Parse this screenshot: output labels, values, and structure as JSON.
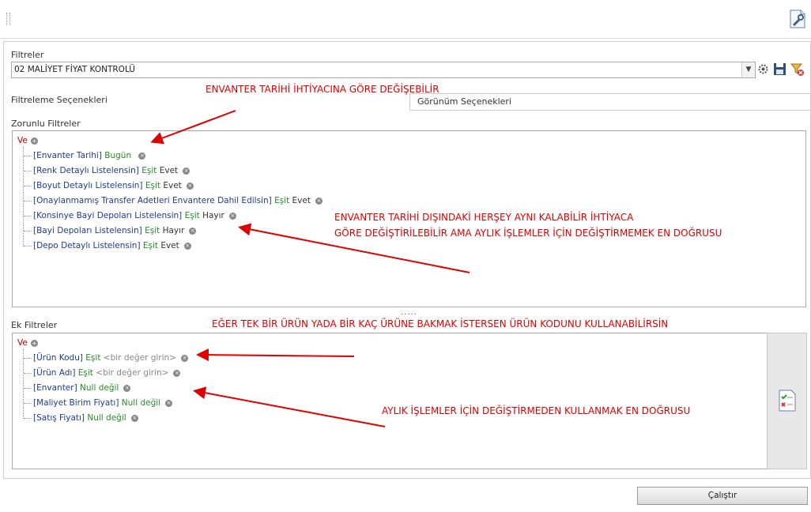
{
  "toolbar": {
    "settings_icon": "wrench-icon"
  },
  "filters": {
    "label": "Filtreler",
    "selected": "02 MALİYET FİYAT KONTROLÜ"
  },
  "tabs": {
    "left": "Filtreleme Seçenekleri",
    "right": "Görünüm Seçenekleri"
  },
  "required": {
    "label": "Zorunlu Filtreler",
    "root": "Ve",
    "items": [
      {
        "field": "[Envanter Tarihi]",
        "op": "Bugün",
        "val": ""
      },
      {
        "field": "[Renk Detaylı Listelensin]",
        "op": "Eşit",
        "val": "Evet"
      },
      {
        "field": "[Boyut Detaylı Listelensin]",
        "op": "Eşit",
        "val": "Evet"
      },
      {
        "field": "[Onaylanmamış Transfer Adetleri Envantere Dahil Edilsin]",
        "op": "Eşit",
        "val": "Evet"
      },
      {
        "field": "[Konsinye Bayi Depoları Listelensin]",
        "op": "Eşit",
        "val": "Hayır"
      },
      {
        "field": "[Bayi Depoları Listelensin]",
        "op": "Eşit",
        "val": "Hayır"
      },
      {
        "field": "[Depo Detaylı Listelensin]",
        "op": "Eşit",
        "val": "Evet"
      }
    ]
  },
  "extra": {
    "label": "Ek Filtreler",
    "root": "Ve",
    "items": [
      {
        "field": "[Ürün Kodu]",
        "op": "Eşit",
        "val": "<bir değer girin>"
      },
      {
        "field": "[Ürün Adı]",
        "op": "Eşit",
        "val": "<bir değer girin>"
      },
      {
        "field": "[Envanter]",
        "op": "Null değil",
        "val": ""
      },
      {
        "field": "[Maliyet Birim Fiyatı]",
        "op": "Null değil",
        "val": ""
      },
      {
        "field": "[Satış Fiyatı]",
        "op": "Null değil",
        "val": ""
      }
    ]
  },
  "splitter": ".....",
  "annotations": {
    "a1": "ENVANTER TARİHİ İHTİYACINA GÖRE DEĞİŞEBİLİR",
    "a2": "ENVANTER TARİHİ DIŞINDAKİ HERŞEY AYNI KALABİLİR İHTİYACA",
    "a3": "GÖRE DEĞİŞTİRİLEBİLİR AMA AYLIK İŞLEMLER İÇİN DEĞİŞTİRMEMEK EN DOĞRUSU",
    "a4": "EĞER TEK BİR ÜRÜN YADA BİR KAÇ ÜRÜNE BAKMAK İSTERSEN ÜRÜN KODUNU KULLANABİLİRSİN",
    "a5": "AYLIK İŞLEMLER İÇİN DEĞİŞTİRMEDEN KULLANMAK EN DOĞRUSU"
  },
  "run_button": "Çalıştır",
  "colors": {
    "annotation": "#e00000",
    "field": "#1f3a93",
    "operator": "#2a8a2a",
    "root": "#c00000"
  }
}
